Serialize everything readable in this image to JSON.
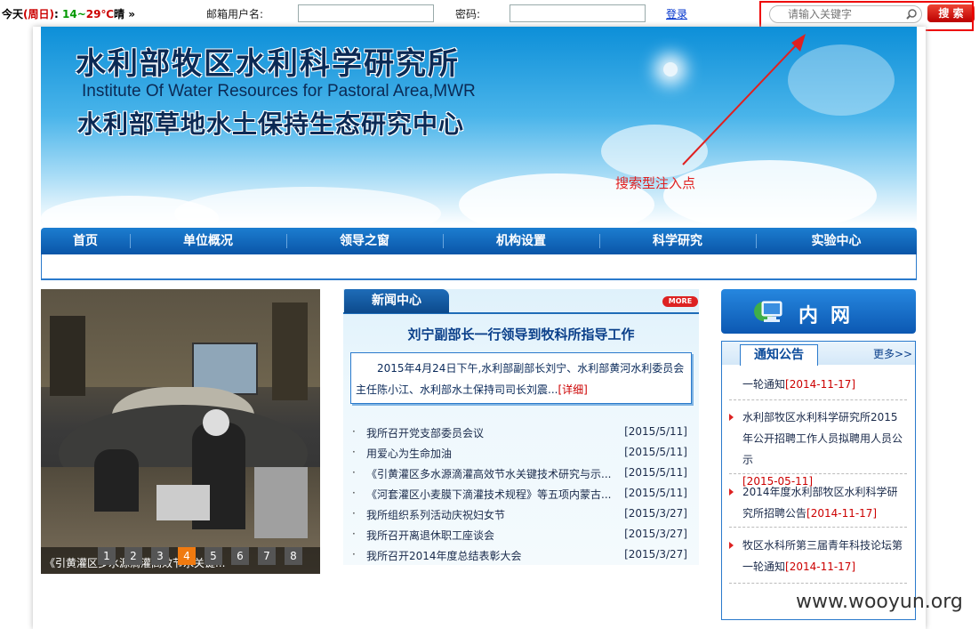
{
  "topbar": {
    "weather_prefix": "今天",
    "weather_day": "(周日)",
    "weather_colon": ":",
    "temp_low": "14",
    "temp_sep": "~",
    "temp_high": "29",
    "temp_unit": "℃",
    "condition": "晴",
    "more_glyph": "»",
    "username_label": "邮箱用户名:",
    "password_label": "密码:",
    "login_link": "登录",
    "search_placeholder": "请输入关键字",
    "search_button": "搜 索"
  },
  "banner": {
    "title_cn": "水利部牧区水利科学研究所",
    "title_en": "Institute Of Water Resources for Pastoral Area,MWR",
    "title_cn2": "水利部草地水土保持生态研究中心",
    "annotation": "搜索型注入点"
  },
  "nav": {
    "items": [
      "首页",
      "单位概况",
      "领导之窗",
      "机构设置",
      "科学研究",
      "实验中心"
    ]
  },
  "slideshow": {
    "caption": "《引黄灌区多水源滴灌高效节水关键...",
    "dots": [
      "1",
      "2",
      "3",
      "4",
      "5",
      "6",
      "7",
      "8"
    ],
    "active_dot": "4"
  },
  "news": {
    "tab_label": "新闻中心",
    "more_label": "MORE",
    "headline": "刘宁副部长一行领导到牧科所指导工作",
    "summary": "2015年4月24日下午,水利部副部长刘宁、水利部黄河水利委员会主任陈小江、水利部水土保持司司长刘震...",
    "detail_link": "[详细]",
    "bullet": "·",
    "items": [
      {
        "title": "我所召开党支部委员会议",
        "date": "[2015/5/11]"
      },
      {
        "title": "用爱心为生命加油",
        "date": "[2015/5/11]"
      },
      {
        "title": "《引黄灌区多水源滴灌高效节水关键技术研究与示...",
        "date": "[2015/5/11]"
      },
      {
        "title": "《河套灌区小麦膜下滴灌技术规程》等五项内蒙古...",
        "date": "[2015/5/11]"
      },
      {
        "title": "我所组织系列活动庆祝妇女节",
        "date": "[2015/3/27]"
      },
      {
        "title": "我所召开离退休职工座谈会",
        "date": "[2015/3/27]"
      },
      {
        "title": "我所召开2014年度总结表彰大会",
        "date": "[2015/3/27]"
      }
    ]
  },
  "intranet": {
    "label": "内网"
  },
  "notice": {
    "tab_label": "通知公告",
    "more_label": "更多>>",
    "items": [
      {
        "text": "一轮通知",
        "date": "[2014-11-17]",
        "bullet": false
      },
      {
        "text": "水利部牧区水利科学研究所2015年公开招聘工作人员拟聘用人员公示",
        "date": "[2015-05-11]",
        "bullet": true
      },
      {
        "text": "2014年度水利部牧区水利科学研究所招聘公告",
        "date": "[2014-11-17]",
        "bullet": true
      },
      {
        "text": "牧区水科所第三届青年科技论坛第一轮通知",
        "date": "[2014-11-17]",
        "bullet": true
      }
    ]
  },
  "watermark": "www.wooyun.org"
}
